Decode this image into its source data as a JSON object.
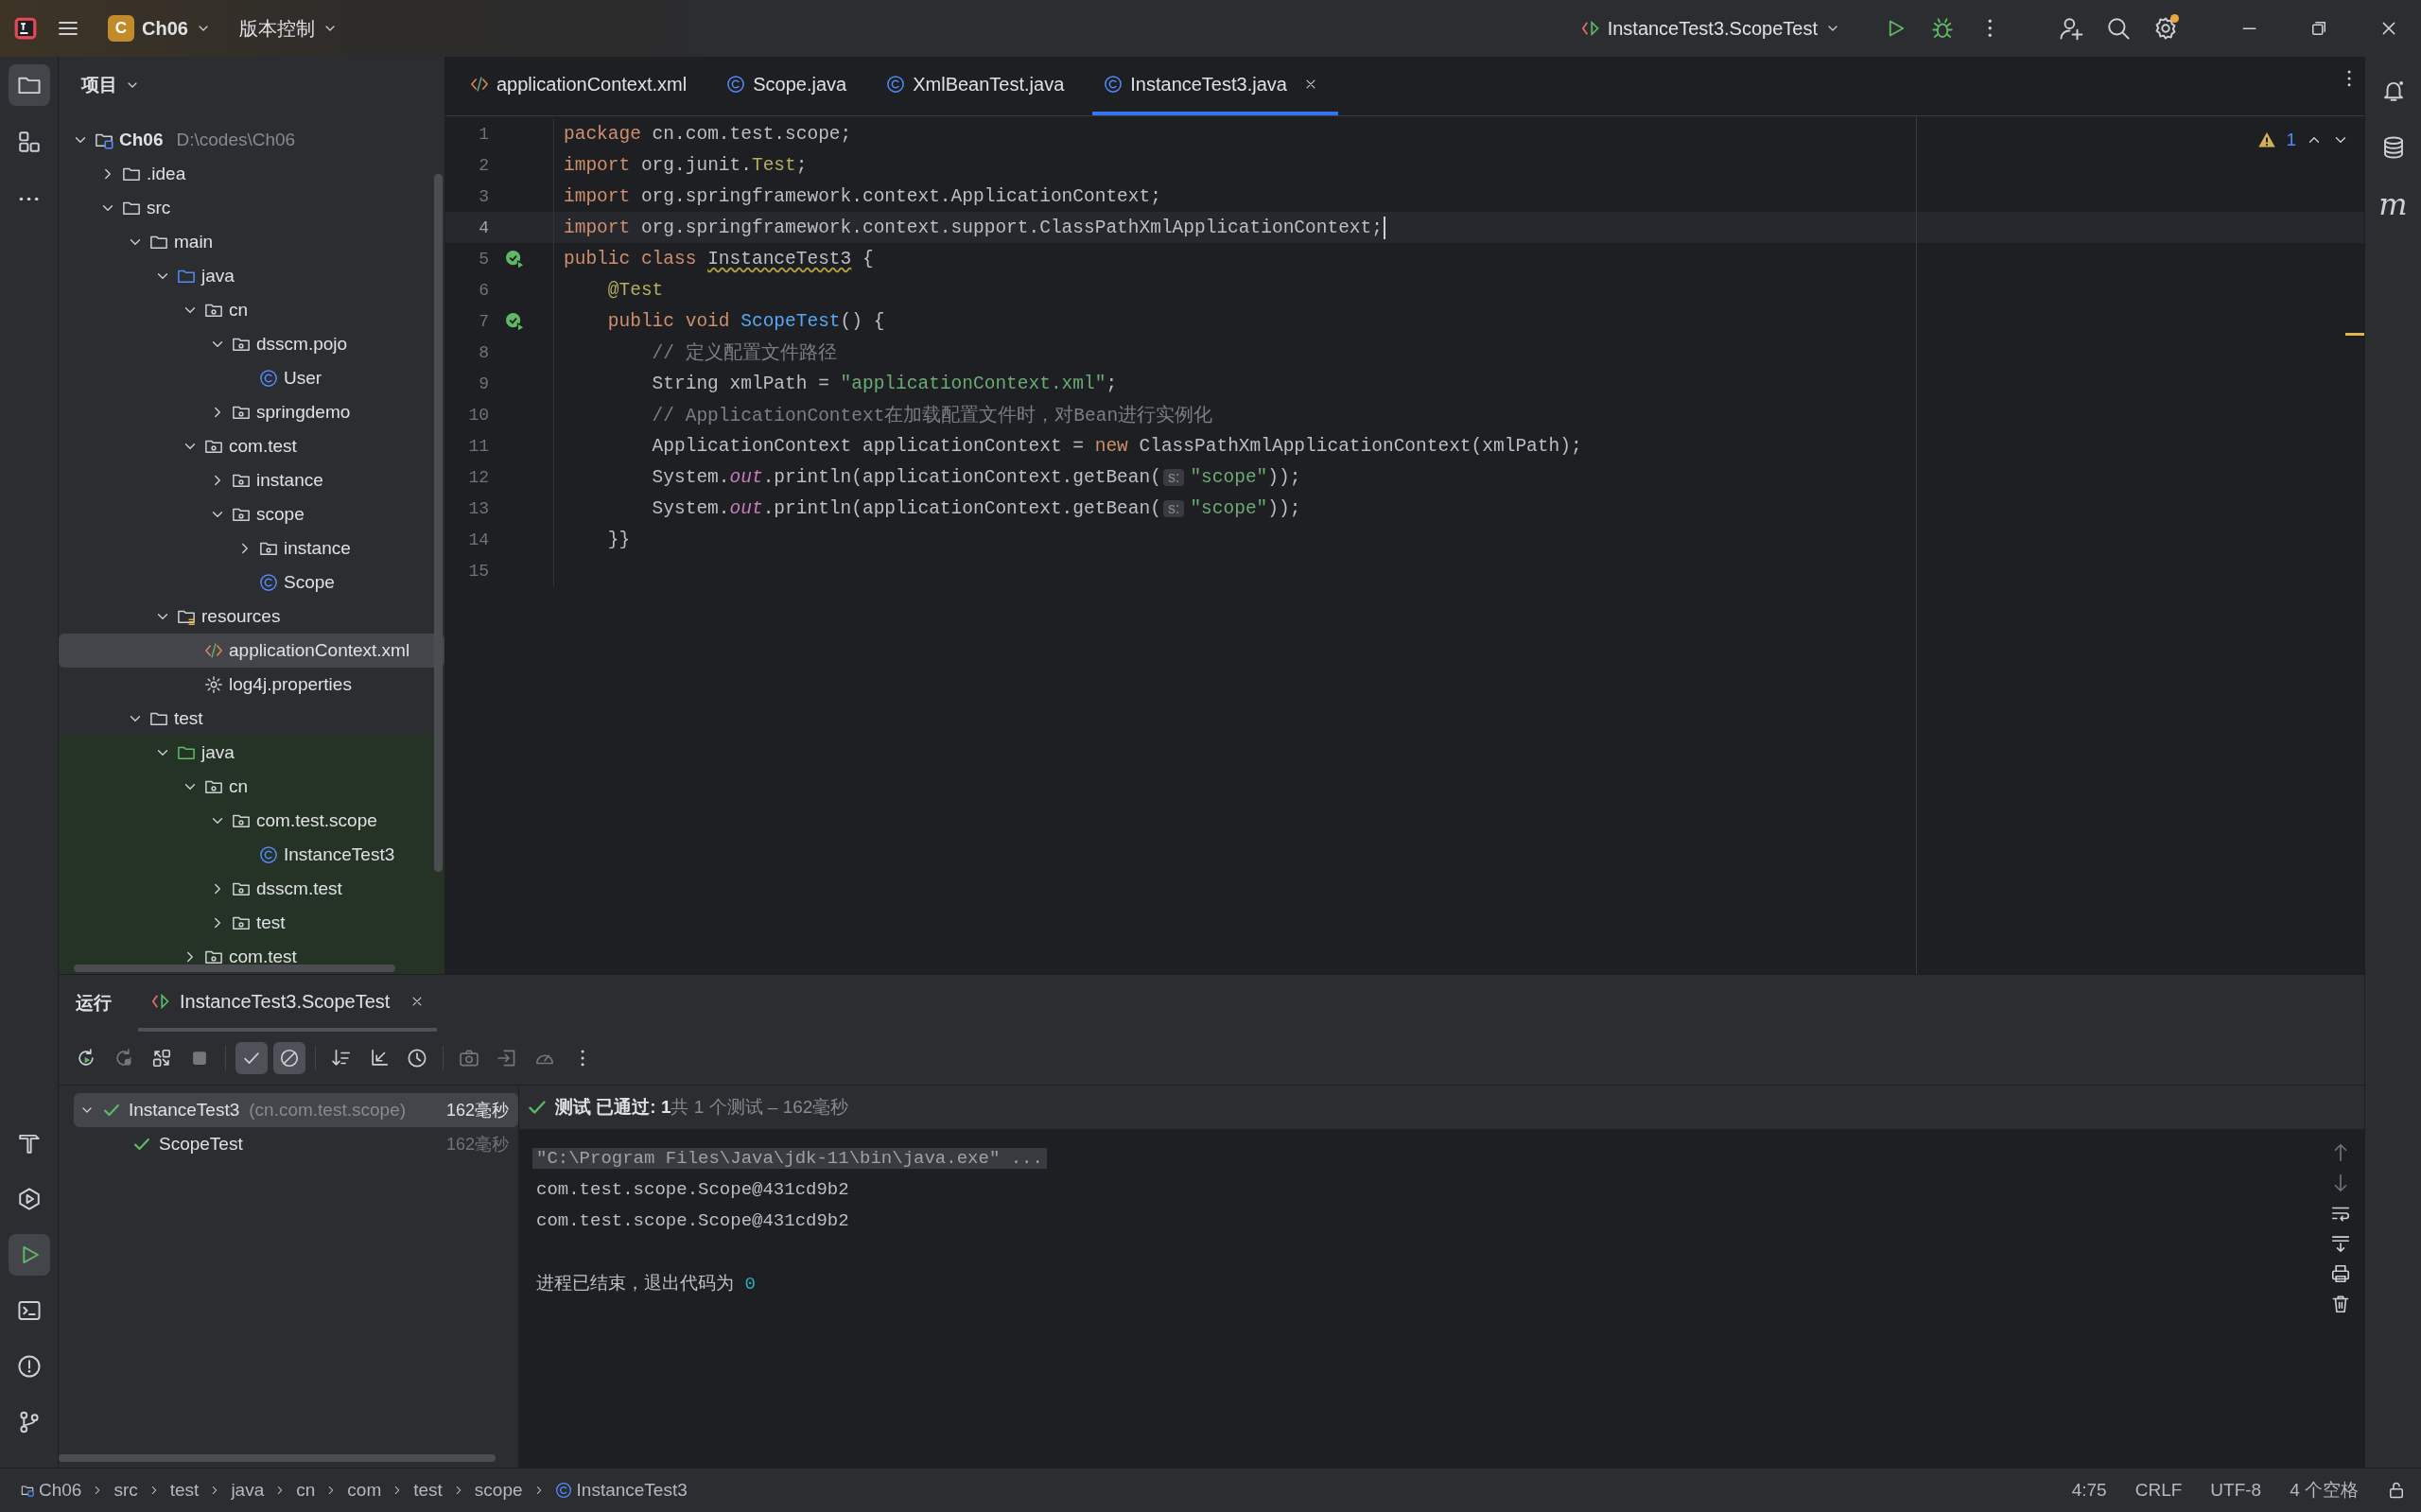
{
  "title_bar": {
    "project": {
      "badge": "C",
      "name": "Ch06"
    },
    "vcs_menu": "版本控制",
    "run_config": "InstanceTest3.ScopeTest",
    "settings_badge": true
  },
  "left_toolbar": {
    "top": [
      {
        "selected": true
      },
      {
        "selected": false
      },
      {
        "selected": false
      }
    ],
    "bottom": [
      {
        "selected": false
      },
      {
        "selected": false
      },
      {
        "selected": true
      },
      {
        "selected": false
      },
      {
        "selected": false
      },
      {
        "selected": false
      }
    ]
  },
  "project_panel": {
    "title": "项目",
    "tree": [
      {
        "name": "Ch06",
        "path": "D:\\codes\\Ch06",
        "kind": "module",
        "expanded": true,
        "selected": false,
        "children": [
          {
            "name": ".idea",
            "kind": "folder",
            "expanded": false,
            "selected": false
          },
          {
            "name": "src",
            "kind": "folder",
            "expanded": true,
            "selected": false,
            "children": [
              {
                "name": "main",
                "kind": "folder",
                "expanded": true,
                "selected": false,
                "children": [
                  {
                    "name": "java",
                    "kind": "source-folder",
                    "expanded": true,
                    "selected": false,
                    "children": [
                      {
                        "name": "cn",
                        "kind": "package",
                        "expanded": true,
                        "selected": false,
                        "children": [
                          {
                            "name": "dsscm.pojo",
                            "kind": "package",
                            "expanded": true,
                            "selected": false,
                            "children": [
                              {
                                "name": "User",
                                "kind": "class",
                                "selected": false
                              }
                            ]
                          },
                          {
                            "name": "springdemo",
                            "kind": "package",
                            "expanded": false,
                            "selected": false
                          }
                        ]
                      },
                      {
                        "name": "com.test",
                        "kind": "package",
                        "expanded": true,
                        "selected": false,
                        "children": [
                          {
                            "name": "instance",
                            "kind": "package",
                            "expanded": false,
                            "selected": false
                          },
                          {
                            "name": "scope",
                            "kind": "package",
                            "expanded": true,
                            "selected": false,
                            "children": [
                              {
                                "name": "instance",
                                "kind": "package",
                                "expanded": false,
                                "selected": false
                              },
                              {
                                "name": "Scope",
                                "kind": "class",
                                "selected": false
                              }
                            ]
                          }
                        ]
                      }
                    ]
                  },
                  {
                    "name": "resources",
                    "kind": "resource-folder",
                    "expanded": true,
                    "selected": false,
                    "children": [
                      {
                        "name": "applicationContext.xml",
                        "kind": "xml",
                        "selected": true
                      },
                      {
                        "name": "log4j.properties",
                        "kind": "properties",
                        "selected": false
                      }
                    ]
                  }
                ]
              },
              {
                "name": "test",
                "kind": "folder",
                "expanded": true,
                "selected": false,
                "children": [
                  {
                    "name": "java",
                    "kind": "test-folder",
                    "expanded": true,
                    "selected": false,
                    "children": [
                      {
                        "name": "cn",
                        "kind": "package",
                        "expanded": true,
                        "selected": false,
                        "children": [
                          {
                            "name": "com.test.scope",
                            "kind": "package",
                            "expanded": true,
                            "selected": false,
                            "children": [
                              {
                                "name": "InstanceTest3",
                                "kind": "class",
                                "selected": false
                              }
                            ]
                          },
                          {
                            "name": "dsscm.test",
                            "kind": "package",
                            "expanded": false,
                            "selected": false
                          },
                          {
                            "name": "test",
                            "kind": "package",
                            "expanded": false,
                            "selected": false
                          }
                        ]
                      },
                      {
                        "name": "com.test",
                        "kind": "package",
                        "expanded": false,
                        "selected": false
                      }
                    ]
                  }
                ]
              }
            ]
          }
        ]
      }
    ]
  },
  "editor": {
    "tabs": [
      {
        "label": "applicationContext.xml",
        "kind": "xml",
        "selected": false
      },
      {
        "label": "Scope.java",
        "kind": "class",
        "selected": false
      },
      {
        "label": "XmlBeanTest.java",
        "kind": "class",
        "selected": false
      },
      {
        "label": "InstanceTest3.java",
        "kind": "class",
        "selected": true
      }
    ],
    "inspection_count": "1",
    "lines": [
      {
        "number": "1",
        "current": false,
        "tokens": [
          {
            "kind": "kw",
            "text": "package"
          },
          {
            "kind": "plain",
            "text": " cn.com.test.scope;"
          }
        ]
      },
      {
        "number": "2",
        "current": false,
        "tokens": [
          {
            "kind": "kw",
            "text": "import"
          },
          {
            "kind": "plain",
            "text": " org.junit."
          },
          {
            "kind": "ann",
            "text": "Test"
          },
          {
            "kind": "plain",
            "text": ";"
          }
        ]
      },
      {
        "number": "3",
        "current": false,
        "tokens": [
          {
            "kind": "kw",
            "text": "import"
          },
          {
            "kind": "plain",
            "text": " org.springframework.context.ApplicationContext;"
          }
        ]
      },
      {
        "number": "4",
        "current": true,
        "tokens": [
          {
            "kind": "kw",
            "text": "import"
          },
          {
            "kind": "plain",
            "text": " org.springframework.context.support.ClassPathXmlApplicationContext;"
          }
        ]
      },
      {
        "number": "5",
        "current": false,
        "run_marker": true,
        "tokens": [
          {
            "kind": "kw",
            "text": "public class "
          },
          {
            "kind": "warn",
            "text": "InstanceTest3"
          },
          {
            "kind": "plain",
            "text": " {"
          }
        ]
      },
      {
        "number": "6",
        "current": false,
        "tokens": [
          {
            "kind": "ann",
            "text": "    @Test"
          }
        ]
      },
      {
        "number": "7",
        "current": false,
        "run_marker": true,
        "tokens": [
          {
            "kind": "kw",
            "text": "    public void "
          },
          {
            "kind": "decl",
            "text": "ScopeTest"
          },
          {
            "kind": "plain",
            "text": "() {"
          }
        ]
      },
      {
        "number": "8",
        "current": false,
        "tokens": [
          {
            "kind": "comment",
            "text": "        // 定义配置文件路径"
          }
        ]
      },
      {
        "number": "9",
        "current": false,
        "tokens": [
          {
            "kind": "plain",
            "text": "        String xmlPath = "
          },
          {
            "kind": "str",
            "text": "\"applicationContext.xml\""
          },
          {
            "kind": "plain",
            "text": ";"
          }
        ]
      },
      {
        "number": "10",
        "current": false,
        "tokens": [
          {
            "kind": "comment",
            "text": "        // ApplicationContext在加载配置文件时，对Bean进行实例化"
          }
        ]
      },
      {
        "number": "11",
        "current": false,
        "tokens": [
          {
            "kind": "plain",
            "text": "        ApplicationContext applicationContext = "
          },
          {
            "kind": "kw",
            "text": "new"
          },
          {
            "kind": "plain",
            "text": " ClassPathXmlApplicationContext(xmlPath);"
          }
        ]
      },
      {
        "number": "12",
        "current": false,
        "tokens": [
          {
            "kind": "plain",
            "text": "        System."
          },
          {
            "kind": "static",
            "text": "out"
          },
          {
            "kind": "plain",
            "text": ".println(applicationContext.getBean("
          },
          {
            "kind": "hint",
            "text": "s:"
          },
          {
            "kind": "str",
            "text": "\"scope\""
          },
          {
            "kind": "plain",
            "text": "));"
          }
        ]
      },
      {
        "number": "13",
        "current": false,
        "tokens": [
          {
            "kind": "plain",
            "text": "        System."
          },
          {
            "kind": "static",
            "text": "out"
          },
          {
            "kind": "plain",
            "text": ".println(applicationContext.getBean("
          },
          {
            "kind": "hint",
            "text": "s:"
          },
          {
            "kind": "str",
            "text": "\"scope\""
          },
          {
            "kind": "plain",
            "text": "));"
          }
        ]
      },
      {
        "number": "14",
        "current": false,
        "tokens": [
          {
            "kind": "plain",
            "text": "    }}"
          }
        ]
      },
      {
        "number": "15",
        "current": false
      }
    ]
  },
  "right_toolbar": [
    {
      "kind": "icon"
    },
    {
      "kind": "icon"
    },
    {
      "kind": "glyph",
      "glyph": "m"
    }
  ],
  "run_panel": {
    "title": "运行",
    "tabs": [
      {
        "label": "InstanceTest3.ScopeTest",
        "selected": true
      }
    ],
    "toolbar": [
      {
        "kind": "button",
        "toggled": false,
        "disabled": false
      },
      {
        "kind": "button",
        "toggled": false,
        "disabled": true
      },
      {
        "kind": "button",
        "toggled": false,
        "disabled": false
      },
      {
        "kind": "button",
        "toggled": false,
        "disabled": true
      },
      {
        "kind": "separator"
      },
      {
        "kind": "button",
        "toggled": true,
        "disabled": false
      },
      {
        "kind": "button",
        "toggled": true,
        "disabled": false
      },
      {
        "kind": "separator"
      },
      {
        "kind": "button",
        "toggled": false,
        "disabled": false
      },
      {
        "kind": "button",
        "toggled": false,
        "disabled": false
      },
      {
        "kind": "button",
        "toggled": false,
        "disabled": false
      },
      {
        "kind": "separator"
      },
      {
        "kind": "button",
        "toggled": false,
        "disabled": true
      },
      {
        "kind": "button",
        "toggled": false,
        "disabled": true
      },
      {
        "kind": "button",
        "toggled": false,
        "disabled": true
      },
      {
        "kind": "button",
        "toggled": false,
        "disabled": false
      }
    ],
    "test_tree": [
      {
        "name": "InstanceTest3",
        "detail": "(cn.com.test.scope)",
        "time": "162毫秒",
        "passed": true,
        "expanded": true,
        "selected": true,
        "children": [
          {
            "name": "ScopeTest",
            "time": "162毫秒",
            "passed": true,
            "selected": false
          }
        ]
      }
    ],
    "summary": {
      "passed": true,
      "status": "测试 已通过: 1",
      "detail": "共 1 个测试 – 162毫秒"
    },
    "console": [
      {
        "kind": "command",
        "text": "\"C:\\Program Files\\Java\\jdk-11\\bin\\java.exe\" ..."
      },
      {
        "kind": "output",
        "text": "com.test.scope.Scope@431cd9b2"
      },
      {
        "kind": "output",
        "text": "com.test.scope.Scope@431cd9b2"
      },
      {
        "kind": "blank"
      },
      {
        "kind": "exit",
        "text": "进程已结束，退出代码为 ",
        "code": "0"
      }
    ]
  },
  "status_bar": {
    "breadcrumbs": [
      {
        "label": "Ch06",
        "kind": "module"
      },
      {
        "label": "src",
        "kind": "folder"
      },
      {
        "label": "test",
        "kind": "folder"
      },
      {
        "label": "java",
        "kind": "folder"
      },
      {
        "label": "cn",
        "kind": "folder"
      },
      {
        "label": "com",
        "kind": "folder"
      },
      {
        "label": "test",
        "kind": "folder"
      },
      {
        "label": "scope",
        "kind": "folder"
      },
      {
        "label": "InstanceTest3",
        "kind": "class"
      }
    ],
    "position": "4:75",
    "line_separator": "CRLF",
    "encoding": "UTF-8",
    "indent": "4 个空格"
  }
}
